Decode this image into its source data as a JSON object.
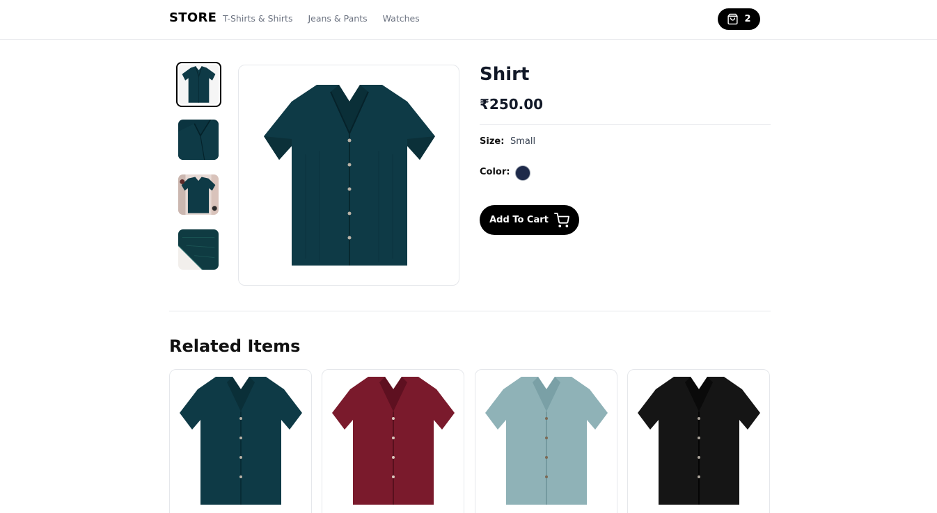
{
  "header": {
    "brand": "STORE",
    "nav": [
      "T-Shirts & Shirts",
      "Jeans & Pants",
      "Watches"
    ],
    "cart_count": "2",
    "cart_icon": "shopping-bag-icon"
  },
  "product": {
    "title": "Shirt",
    "price": "₹250.00",
    "size_label": "Size:",
    "size_value": "Small",
    "color_label": "Color:",
    "color_swatch": "#1e2a4a",
    "add_to_cart_label": "Add To Cart",
    "add_to_cart_icon": "shopping-cart-icon",
    "gallery": [
      {
        "kind": "front",
        "color": "#0e3a46"
      },
      {
        "kind": "collar-detail",
        "color": "#0e3a46"
      },
      {
        "kind": "lifestyle",
        "color": "#0e3a46"
      },
      {
        "kind": "fabric-detail",
        "color": "#0e3a46"
      }
    ],
    "main_image_color": "#0e3a46"
  },
  "related": {
    "title": "Related Items",
    "items": [
      {
        "color": "#0e3a46"
      },
      {
        "color": "#7a1a2c"
      },
      {
        "color": "#8fb2b7"
      },
      {
        "color": "#151515"
      }
    ]
  }
}
